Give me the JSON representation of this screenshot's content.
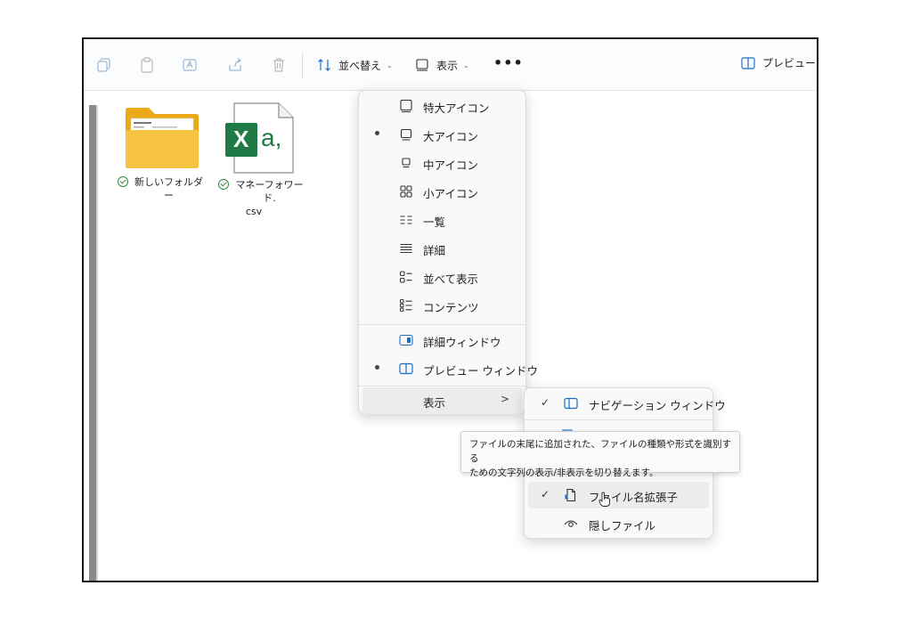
{
  "toolbar": {
    "sort_label": "並べ替え",
    "view_label": "表示",
    "more_label": "•••",
    "preview_label": "プレビュー"
  },
  "files": [
    {
      "name": "新しいフォルダー",
      "type": "folder"
    },
    {
      "name_line1": "マネーフォワード.",
      "name_line2": "csv",
      "type": "excel-csv",
      "icon_text": "X",
      "icon_text2": "a,"
    }
  ],
  "view_menu": {
    "items": [
      {
        "label": "特大アイコン",
        "selected": false
      },
      {
        "label": "大アイコン",
        "selected": true
      },
      {
        "label": "中アイコン",
        "selected": false
      },
      {
        "label": "小アイコン",
        "selected": false
      },
      {
        "label": "一覧",
        "selected": false
      },
      {
        "label": "詳細",
        "selected": false
      },
      {
        "label": "並べて表示",
        "selected": false
      },
      {
        "label": "コンテンツ",
        "selected": false
      }
    ],
    "panes": [
      {
        "label": "詳細ウィンドウ",
        "selected": false
      },
      {
        "label": "プレビュー ウィンドウ",
        "selected": true
      }
    ],
    "show_label": "表示",
    "show_arrow": ">"
  },
  "show_menu": {
    "items": [
      {
        "label": "ナビゲーション ウィンドウ",
        "checked": true
      },
      {
        "label": "ファイル名拡張子",
        "checked": true
      },
      {
        "label": "隠しファイル",
        "checked": false
      }
    ],
    "check_glyph": "✓"
  },
  "tooltip": {
    "line1": "ファイルの末尾に追加された、ファイルの種類や形式を識別する",
    "line2": "ための文字列の表示/非表示を切り替えます。"
  },
  "colors": {
    "folder_yellow": "#f5c242",
    "excel_green": "#1f7a45",
    "sync_green": "#2e8b3d",
    "accent_blue": "#1a6fc4"
  }
}
